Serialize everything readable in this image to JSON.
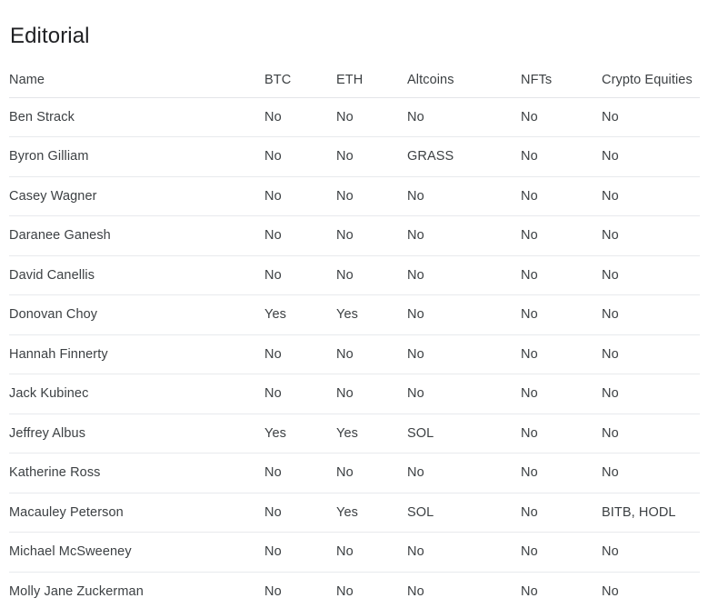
{
  "page": {
    "title": "Editorial"
  },
  "table": {
    "columns": [
      {
        "key": "name",
        "label": "Name"
      },
      {
        "key": "btc",
        "label": "BTC"
      },
      {
        "key": "eth",
        "label": "ETH"
      },
      {
        "key": "alt",
        "label": "Altcoins"
      },
      {
        "key": "nft",
        "label": "NFTs"
      },
      {
        "key": "equity",
        "label": "Crypto Equities"
      }
    ],
    "rows": [
      {
        "name": "Ben Strack",
        "btc": "No",
        "eth": "No",
        "alt": "No",
        "nft": "No",
        "equity": "No"
      },
      {
        "name": "Byron Gilliam",
        "btc": "No",
        "eth": "No",
        "alt": "GRASS",
        "nft": "No",
        "equity": "No"
      },
      {
        "name": "Casey Wagner",
        "btc": "No",
        "eth": "No",
        "alt": "No",
        "nft": "No",
        "equity": "No"
      },
      {
        "name": "Daranee Ganesh",
        "btc": "No",
        "eth": "No",
        "alt": "No",
        "nft": "No",
        "equity": "No"
      },
      {
        "name": "David Canellis",
        "btc": "No",
        "eth": "No",
        "alt": "No",
        "nft": "No",
        "equity": "No"
      },
      {
        "name": "Donovan Choy",
        "btc": "Yes",
        "eth": "Yes",
        "alt": "No",
        "nft": "No",
        "equity": "No"
      },
      {
        "name": "Hannah Finnerty",
        "btc": "No",
        "eth": "No",
        "alt": "No",
        "nft": "No",
        "equity": "No"
      },
      {
        "name": "Jack Kubinec",
        "btc": "No",
        "eth": "No",
        "alt": "No",
        "nft": "No",
        "equity": "No"
      },
      {
        "name": "Jeffrey Albus",
        "btc": "Yes",
        "eth": "Yes",
        "alt": "SOL",
        "nft": "No",
        "equity": "No"
      },
      {
        "name": "Katherine Ross",
        "btc": "No",
        "eth": "No",
        "alt": "No",
        "nft": "No",
        "equity": "No"
      },
      {
        "name": "Macauley Peterson",
        "btc": "No",
        "eth": "Yes",
        "alt": "SOL",
        "nft": "No",
        "equity": "BITB, HODL"
      },
      {
        "name": "Michael McSweeney",
        "btc": "No",
        "eth": "No",
        "alt": "No",
        "nft": "No",
        "equity": "No"
      },
      {
        "name": "Molly Jane Zuckerman",
        "btc": "No",
        "eth": "No",
        "alt": "No",
        "nft": "No",
        "equity": "No"
      }
    ]
  },
  "colors": {
    "background": "#ffffff",
    "title_text": "#202124",
    "body_text": "#3c4043",
    "row_divider": "#e8eaed",
    "header_divider": "#e3e5e8"
  }
}
